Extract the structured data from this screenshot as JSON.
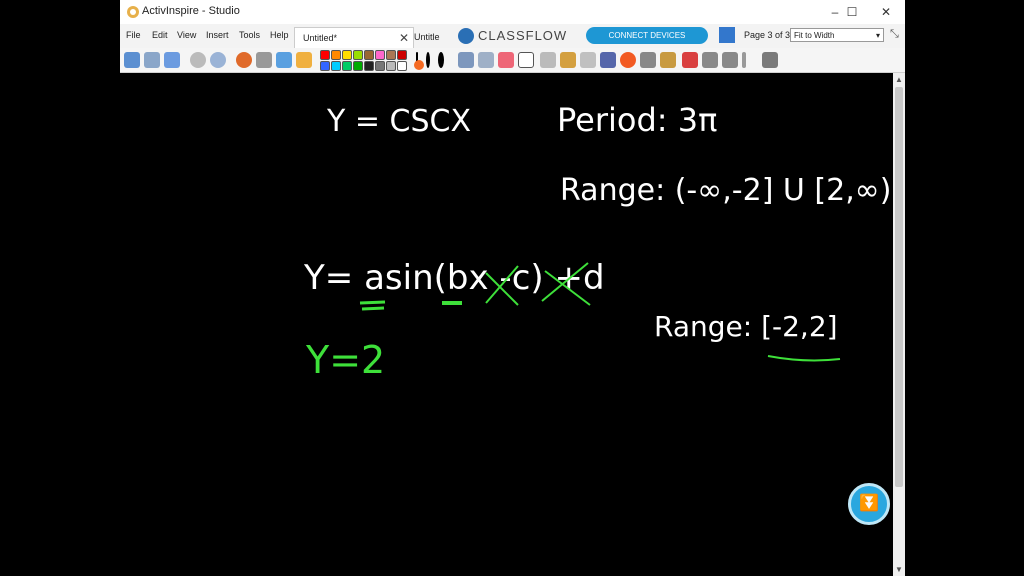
{
  "window": {
    "title": "ActivInspire - Studio",
    "controls": {
      "minimize": "–",
      "maximize": "☐",
      "close": "✕"
    }
  },
  "menu": {
    "items": [
      "File",
      "Edit",
      "View",
      "Insert",
      "Tools",
      "Help"
    ]
  },
  "tabs": [
    {
      "label": "Untitled*",
      "close": "✕"
    },
    {
      "label": "Untitle"
    }
  ],
  "classflow": {
    "brand": "CLASSFLOW",
    "connect_label": "CONNECT DEVICES"
  },
  "page_indicator": "Page 3 of 3",
  "zoom": {
    "value": "Fit to Width",
    "arrow": "▾"
  },
  "colors": {
    "palette_row1": [
      "#ff0000",
      "#ff8800",
      "#ffdd00",
      "#99dd00",
      "#996633",
      "#ff66cc",
      "#aa7755",
      "#cc0000"
    ],
    "palette_row2": [
      "#3366ff",
      "#00ccff",
      "#00cc66",
      "#00aa00",
      "#222222",
      "#777777",
      "#bbbbbb",
      "#ffffff"
    ],
    "accent": "#1e97d4",
    "ink_white": "#ffffff",
    "ink_green": "#3ee03a"
  },
  "canvas": {
    "line_y_csc": "Y = CSCX",
    "period": "Period: 3π",
    "range_1": "Range: (-∞,-2] U [2,∞)",
    "general_form_start": "Y= ",
    "general_form_a": "a",
    "general_form_sin": "sin(",
    "general_form_b": "b",
    "general_form_x": "x",
    "general_form_c": " -c",
    "general_form_paren": ")",
    "general_form_d": " +d",
    "y_equals_2": "Y=2",
    "range_2": "Range: [-2,2]"
  },
  "scroll": {
    "up": "▲",
    "down": "▼"
  },
  "fab_icon": "⏬"
}
